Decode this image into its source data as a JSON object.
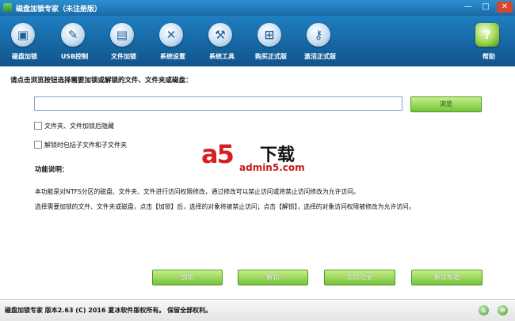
{
  "window": {
    "title": "磁盘加锁专家（未注册版）",
    "minimize": "—",
    "maximize": "□",
    "close": "✕"
  },
  "toolbar": {
    "items": [
      {
        "label": "磁盘加锁",
        "icon": "disk-icon",
        "glyph": "▣"
      },
      {
        "label": "USB控制",
        "icon": "usb-icon",
        "glyph": "✎"
      },
      {
        "label": "文件加锁",
        "icon": "file-icon",
        "glyph": "▤"
      },
      {
        "label": "系统设置",
        "icon": "tools-icon",
        "glyph": "✕"
      },
      {
        "label": "系统工具",
        "icon": "hammer-icon",
        "glyph": "⚒"
      },
      {
        "label": "购买正式版",
        "icon": "cart-icon",
        "glyph": "⊞"
      },
      {
        "label": "激活正式版",
        "icon": "key-icon",
        "glyph": "⚷"
      },
      {
        "label": "帮助",
        "icon": "help-icon",
        "glyph": "?"
      }
    ]
  },
  "main": {
    "prompt": "请点击浏览按钮选择需要加锁或解锁的文件、文件夹或磁盘：",
    "path_value": "",
    "browse_label": "浏览",
    "options": [
      {
        "label": "文件夹、文件加锁后隐藏",
        "checked": false
      },
      {
        "label": "解锁时包括子文件和子文件夹",
        "checked": false
      }
    ],
    "section_title": "功能说明：",
    "desc_line1": "本功能是对NTFS分区的磁盘、文件夹、文件进行访问权限修改，通过修改可以禁止访问或将禁止访问修改为允许访问。",
    "desc_line2": "选择需要加锁的文件、文件夹或磁盘，点击【加锁】后，选择的对象将被禁止访问；点击【解锁】，选择的对象访问权限被修改为允许访问。"
  },
  "watermark": {
    "logo": "a5",
    "title": "下载",
    "url": "admin5.com"
  },
  "actions": {
    "lock": "加锁",
    "unlock": "解锁",
    "log": "加锁记录",
    "help": "解锁帮助"
  },
  "status": {
    "text": "磁盘加锁专家 版本2.63 (C) 2016 夏冰软件版权所有。 保留全部权利。"
  }
}
